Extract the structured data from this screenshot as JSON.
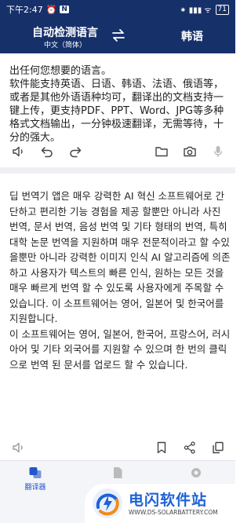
{
  "status_bar": {
    "time": "下午2:47",
    "alarm_icon": "alarm-icon",
    "app_badge": "N",
    "right_text": "⁕ ▮▮▮ ᯤ",
    "battery": "71"
  },
  "header": {
    "source_language": "自动检测语言",
    "source_language_sub": "中文（简体）",
    "target_language": "韩语"
  },
  "source_text": "出任何您想要的语言。\n软件能支持英语、日语、韩语、法语、俄语等，或者是其他外语语种均可，翻译出的文档支持一键上传，更支持PDF、PPT、Word、JPG等多种格式文档输出，一分钟极速翻译，无需等待，十分的强大。",
  "result_paragraphs": [
    "딥 번역기 앱은 매우 강력한 AI 혁신 소프트웨어로 간단하고 편리한 기능 경험을 제공 할뿐만 아니라 사진 번역, 문서 번역, 음성 번역 및 기타 형태의 번역, 특히 대학 논문 번역을 지원하며 매우 전문적이라고 할 수있을뿐만 아니라 강력한 이미지 인식 AI 알고리즘에 의존하고 사용자가 텍스트의 빠른 인식, 원하는 모든 것을 매우 빠르게 번역 할 수 있도록 사용자에게 주목할 수 있습니다. 이 소프트웨어는 영어, 일본어 및 한국어를 지원합니다.",
    "이 소프트웨어는 영어, 일본어, 한국어, 프랑스어, 러시아어 및 기타 외국어를 지원할 수 있으며 한 번의 클릭으로 번역 된 문서를 업로드 할 수 있습니다."
  ],
  "bottom_nav": {
    "items": [
      {
        "label": "翻译器",
        "icon": "translate-icon",
        "active": true
      },
      {
        "label": "",
        "icon": "document-icon",
        "active": false
      },
      {
        "label": "",
        "icon": "settings-icon",
        "active": false
      }
    ]
  },
  "watermark": {
    "title": "电闪软件站",
    "url": "WWW.DS-SOLARBATTERY.COM"
  },
  "colors": {
    "header_bg": "#16306a",
    "accent": "#2456c8",
    "watermark_blue": "#1e62d6"
  }
}
